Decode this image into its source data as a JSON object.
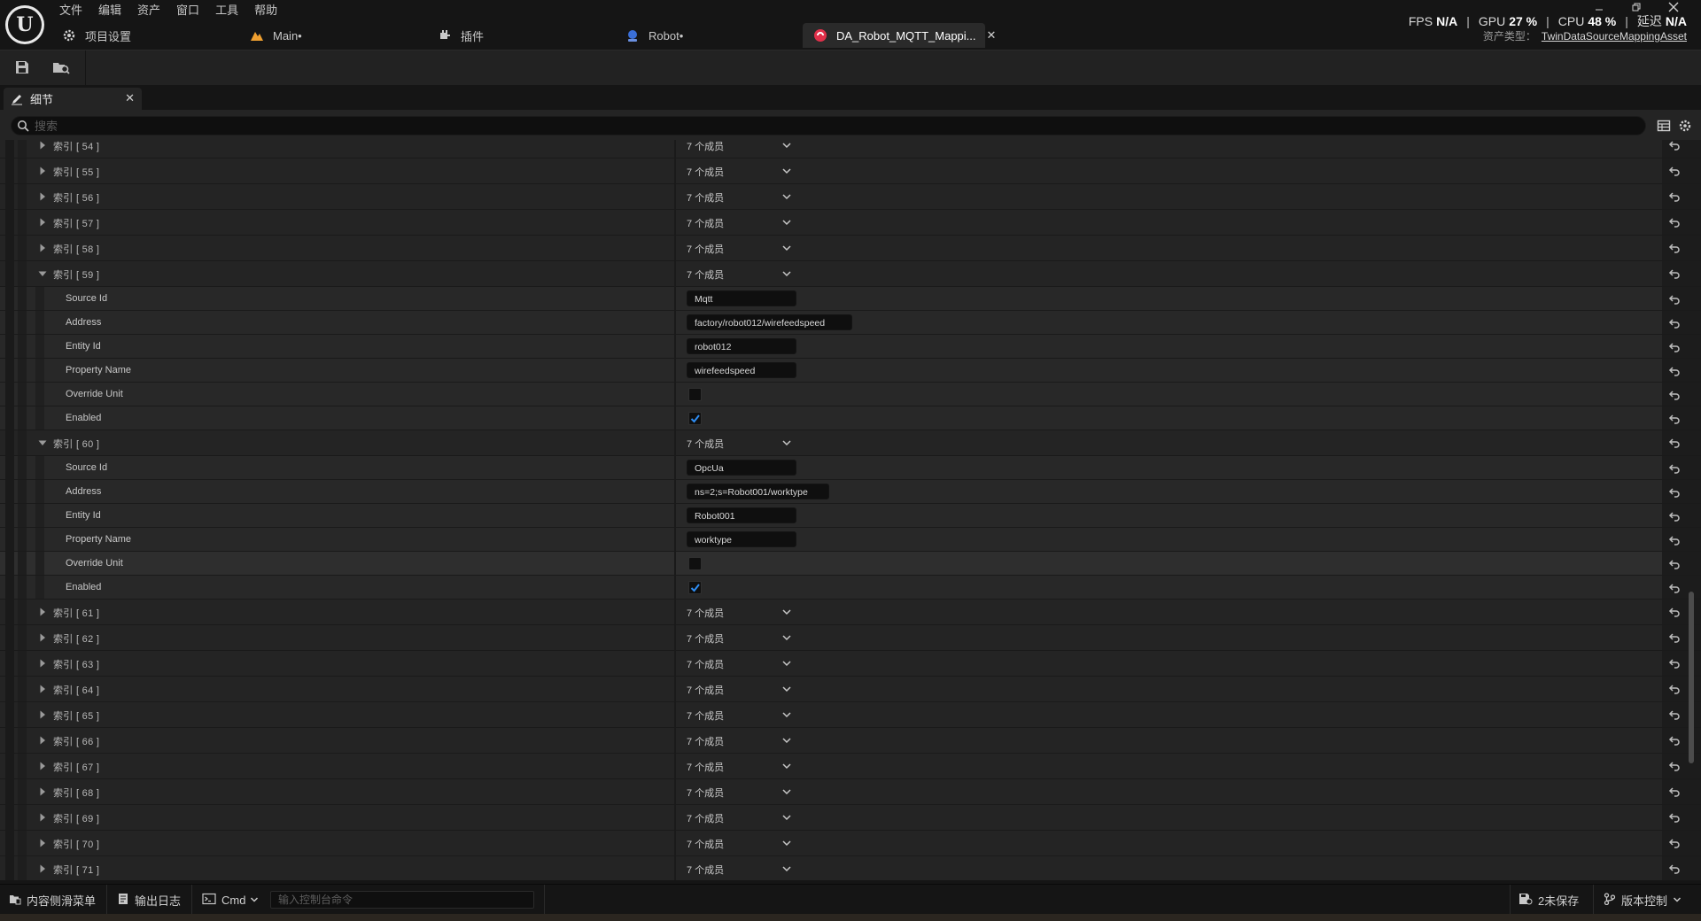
{
  "menubar": {
    "items": [
      "文件",
      "编辑",
      "资产",
      "窗口",
      "工具",
      "帮助"
    ]
  },
  "tabs": [
    {
      "label": "项目设置",
      "icon": "gear-icon"
    },
    {
      "label": "Main•",
      "icon": "level-icon"
    },
    {
      "label": "插件",
      "icon": "plugin-icon"
    },
    {
      "label": "Robot•",
      "icon": "blueprint-icon"
    },
    {
      "label": "DA_Robot_MQTT_Mappi...",
      "icon": "data-asset-icon",
      "close": "✕"
    }
  ],
  "stats": {
    "fps_label": "FPS",
    "fps_value": "N/A",
    "gpu_label": "GPU",
    "gpu_value": "27 %",
    "cpu_label": "CPU",
    "cpu_value": "48 %",
    "latency_label": "延迟",
    "latency_value": "N/A",
    "sep": "|"
  },
  "asset_type": {
    "label": "资产类型：",
    "value": "TwinDataSourceMappingAsset"
  },
  "details_panel": {
    "tab_label": "细节",
    "tab_close": "✕",
    "search_placeholder": "搜索"
  },
  "rows": [
    {
      "kind": "index",
      "label": "索引 [ 54 ]",
      "value": "7 个成员",
      "expanded": false
    },
    {
      "kind": "index",
      "label": "索引 [ 55 ]",
      "value": "7 个成员",
      "expanded": false
    },
    {
      "kind": "index",
      "label": "索引 [ 56 ]",
      "value": "7 个成员",
      "expanded": false
    },
    {
      "kind": "index",
      "label": "索引 [ 57 ]",
      "value": "7 个成员",
      "expanded": false
    },
    {
      "kind": "index",
      "label": "索引 [ 58 ]",
      "value": "7 个成员",
      "expanded": false
    },
    {
      "kind": "index",
      "label": "索引 [ 59 ]",
      "value": "7 个成员",
      "expanded": true
    },
    {
      "kind": "text",
      "label": "Source Id",
      "value": "Mqtt",
      "width": "normal"
    },
    {
      "kind": "text",
      "label": "Address",
      "value": "factory/robot012/wirefeedspeed",
      "width": "wide"
    },
    {
      "kind": "text",
      "label": "Entity Id",
      "value": "robot012",
      "width": "normal"
    },
    {
      "kind": "text",
      "label": "Property Name",
      "value": "wirefeedspeed",
      "width": "normal"
    },
    {
      "kind": "check",
      "label": "Override Unit",
      "checked": false
    },
    {
      "kind": "check",
      "label": "Enabled",
      "checked": true
    },
    {
      "kind": "index",
      "label": "索引 [ 60 ]",
      "value": "7 个成员",
      "expanded": true
    },
    {
      "kind": "text",
      "label": "Source Id",
      "value": "OpcUa",
      "width": "normal"
    },
    {
      "kind": "text",
      "label": "Address",
      "value": "ns=2;s=Robot001/worktype",
      "width": "mid"
    },
    {
      "kind": "text",
      "label": "Entity Id",
      "value": "Robot001",
      "width": "normal"
    },
    {
      "kind": "text",
      "label": "Property Name",
      "value": "worktype",
      "width": "normal"
    },
    {
      "kind": "check",
      "label": "Override Unit",
      "checked": false,
      "highlight": true
    },
    {
      "kind": "check",
      "label": "Enabled",
      "checked": true
    },
    {
      "kind": "index",
      "label": "索引 [ 61 ]",
      "value": "7 个成员",
      "expanded": false
    },
    {
      "kind": "index",
      "label": "索引 [ 62 ]",
      "value": "7 个成员",
      "expanded": false
    },
    {
      "kind": "index",
      "label": "索引 [ 63 ]",
      "value": "7 个成员",
      "expanded": false
    },
    {
      "kind": "index",
      "label": "索引 [ 64 ]",
      "value": "7 个成员",
      "expanded": false
    },
    {
      "kind": "index",
      "label": "索引 [ 65 ]",
      "value": "7 个成员",
      "expanded": false
    },
    {
      "kind": "index",
      "label": "索引 [ 66 ]",
      "value": "7 个成员",
      "expanded": false
    },
    {
      "kind": "index",
      "label": "索引 [ 67 ]",
      "value": "7 个成员",
      "expanded": false
    },
    {
      "kind": "index",
      "label": "索引 [ 68 ]",
      "value": "7 个成员",
      "expanded": false
    },
    {
      "kind": "index",
      "label": "索引 [ 69 ]",
      "value": "7 个成员",
      "expanded": false
    },
    {
      "kind": "index",
      "label": "索引 [ 70 ]",
      "value": "7 个成员",
      "expanded": false
    },
    {
      "kind": "index",
      "label": "索引 [ 71 ]",
      "value": "7 个成员",
      "expanded": false
    }
  ],
  "statusbar": {
    "content_drawer": "内容侧滑菜单",
    "output_log": "输出日志",
    "cmd": "Cmd",
    "console_placeholder": "输入控制台命令",
    "unsaved": "2未保存",
    "source_control": "版本控制"
  },
  "colors": {
    "background": "#151515",
    "panel": "#242424",
    "checkbox_accent": "#2f8ef4",
    "active_tab_icon": "#e0304a",
    "level_icon": "#f0a030",
    "blueprint_icon": "#3a6fd8"
  }
}
